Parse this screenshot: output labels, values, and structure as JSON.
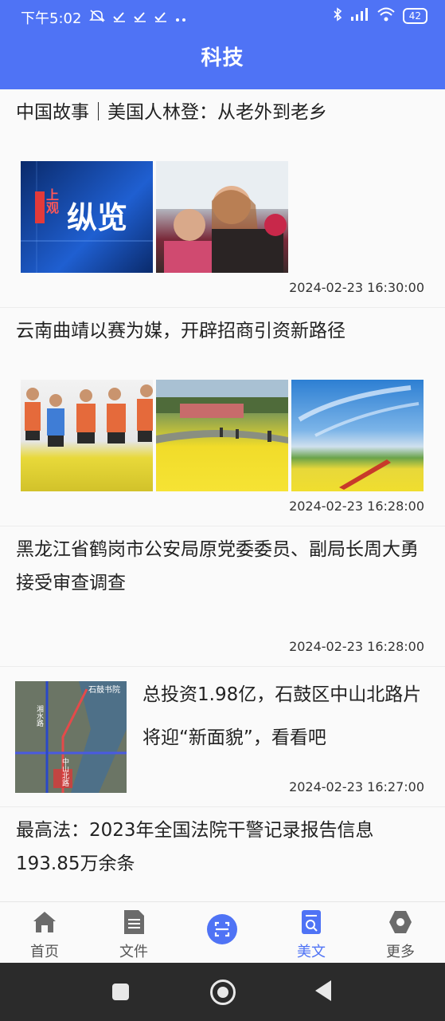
{
  "status_bar": {
    "time": "下午5:02",
    "battery": "42"
  },
  "header": {
    "title": "科技"
  },
  "feed": [
    {
      "title": "中国故事｜美国人林登：从老外到老乡",
      "time": "2024-02-23 16:30:00",
      "thumb_text": "纵览",
      "thumb_badge": "上观"
    },
    {
      "title": "云南曲靖以赛为媒，开辟招商引资新路径",
      "time": "2024-02-23 16:28:00"
    },
    {
      "title": "黑龙江省鹤岗市公安局原党委委员、副局长周大勇接受审查调查",
      "time": "2024-02-23 16:28:00"
    },
    {
      "title": "总投资1.98亿，石鼓区中山北路片将迎“新面貌”，看看吧",
      "time": "2024-02-23 16:27:00",
      "map_labels": {
        "top": "石鼓书院",
        "left": "湘水路",
        "road": "中山北路"
      }
    },
    {
      "title": "最高法：2023年全国法院干警记录报告信息193.85万余条"
    }
  ],
  "bottom_nav": [
    {
      "label": "首页",
      "icon": "home-icon"
    },
    {
      "label": "文件",
      "icon": "document-icon"
    },
    {
      "label": "",
      "icon": "scan-icon"
    },
    {
      "label": "美文",
      "icon": "article-search-icon",
      "active": true
    },
    {
      "label": "更多",
      "icon": "hexagon-icon"
    }
  ],
  "colors": {
    "primary": "#4f73f5",
    "header_text": "#ffffff"
  }
}
